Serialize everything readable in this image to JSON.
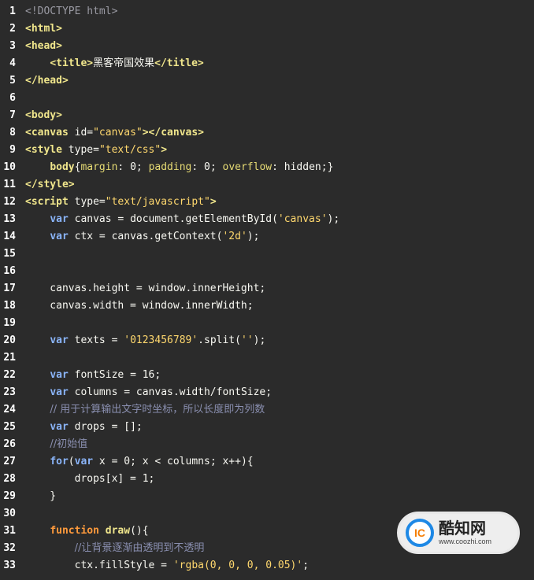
{
  "lines": [
    {
      "n": "1",
      "tokens": [
        {
          "c": "doctype",
          "t": "<!DOCTYPE html>"
        }
      ]
    },
    {
      "n": "2",
      "tokens": [
        {
          "c": "tag",
          "t": "<html>"
        }
      ]
    },
    {
      "n": "3",
      "tokens": [
        {
          "c": "tag",
          "t": "<head>"
        }
      ]
    },
    {
      "n": "4",
      "tokens": [
        {
          "c": "plain",
          "t": "    "
        },
        {
          "c": "tag",
          "t": "<title>"
        },
        {
          "c": "plain cjk",
          "t": "黑客帝国效果"
        },
        {
          "c": "tag",
          "t": "</title>"
        }
      ]
    },
    {
      "n": "5",
      "tokens": [
        {
          "c": "tag",
          "t": "</head>"
        }
      ]
    },
    {
      "n": "6",
      "tokens": []
    },
    {
      "n": "7",
      "tokens": [
        {
          "c": "tag",
          "t": "<body>"
        }
      ]
    },
    {
      "n": "8",
      "tokens": [
        {
          "c": "tag",
          "t": "<canvas"
        },
        {
          "c": "attr",
          "t": " id="
        },
        {
          "c": "str",
          "t": "\"canvas\""
        },
        {
          "c": "tag",
          "t": "></canvas>"
        }
      ]
    },
    {
      "n": "9",
      "tokens": [
        {
          "c": "tag",
          "t": "<style"
        },
        {
          "c": "attr",
          "t": " type="
        },
        {
          "c": "str",
          "t": "\"text/css\""
        },
        {
          "c": "tag",
          "t": ">"
        }
      ]
    },
    {
      "n": "10",
      "tokens": [
        {
          "c": "plain",
          "t": "    "
        },
        {
          "c": "tag",
          "t": "body"
        },
        {
          "c": "plain",
          "t": "{"
        },
        {
          "c": "prop",
          "t": "margin"
        },
        {
          "c": "plain",
          "t": ": 0; "
        },
        {
          "c": "prop",
          "t": "padding"
        },
        {
          "c": "plain",
          "t": ": 0; "
        },
        {
          "c": "prop",
          "t": "overflow"
        },
        {
          "c": "plain",
          "t": ": hidden;}"
        }
      ]
    },
    {
      "n": "11",
      "tokens": [
        {
          "c": "tag",
          "t": "</style>"
        }
      ]
    },
    {
      "n": "12",
      "tokens": [
        {
          "c": "tag",
          "t": "<script"
        },
        {
          "c": "attr",
          "t": " type="
        },
        {
          "c": "str",
          "t": "\"text/javascript\""
        },
        {
          "c": "tag",
          "t": ">"
        }
      ]
    },
    {
      "n": "13",
      "tokens": [
        {
          "c": "plain",
          "t": "    "
        },
        {
          "c": "kw",
          "t": "var"
        },
        {
          "c": "plain",
          "t": " canvas = document.getElementById("
        },
        {
          "c": "str",
          "t": "'canvas'"
        },
        {
          "c": "plain",
          "t": ");"
        }
      ]
    },
    {
      "n": "14",
      "tokens": [
        {
          "c": "plain",
          "t": "    "
        },
        {
          "c": "kw",
          "t": "var"
        },
        {
          "c": "plain",
          "t": " ctx = canvas.getContext("
        },
        {
          "c": "str",
          "t": "'2d'"
        },
        {
          "c": "plain",
          "t": ");"
        }
      ]
    },
    {
      "n": "15",
      "tokens": []
    },
    {
      "n": "16",
      "tokens": []
    },
    {
      "n": "17",
      "tokens": [
        {
          "c": "plain",
          "t": "    canvas.height = window.innerHeight;"
        }
      ]
    },
    {
      "n": "18",
      "tokens": [
        {
          "c": "plain",
          "t": "    canvas.width = window.innerWidth;"
        }
      ]
    },
    {
      "n": "19",
      "tokens": []
    },
    {
      "n": "20",
      "tokens": [
        {
          "c": "plain",
          "t": "    "
        },
        {
          "c": "kw",
          "t": "var"
        },
        {
          "c": "plain",
          "t": " texts = "
        },
        {
          "c": "str",
          "t": "'0123456789'"
        },
        {
          "c": "plain",
          "t": ".split("
        },
        {
          "c": "str",
          "t": "''"
        },
        {
          "c": "plain",
          "t": ");"
        }
      ]
    },
    {
      "n": "21",
      "tokens": []
    },
    {
      "n": "22",
      "tokens": [
        {
          "c": "plain",
          "t": "    "
        },
        {
          "c": "kw",
          "t": "var"
        },
        {
          "c": "plain",
          "t": " fontSize = 16;"
        }
      ]
    },
    {
      "n": "23",
      "tokens": [
        {
          "c": "plain",
          "t": "    "
        },
        {
          "c": "kw",
          "t": "var"
        },
        {
          "c": "plain",
          "t": " columns = canvas.width/fontSize;"
        }
      ]
    },
    {
      "n": "24",
      "tokens": [
        {
          "c": "plain",
          "t": "    "
        },
        {
          "c": "cm cjk",
          "t": "// 用于计算输出文字时坐标，所以长度即为列数"
        }
      ]
    },
    {
      "n": "25",
      "tokens": [
        {
          "c": "plain",
          "t": "    "
        },
        {
          "c": "kw",
          "t": "var"
        },
        {
          "c": "plain",
          "t": " drops = [];"
        }
      ]
    },
    {
      "n": "26",
      "tokens": [
        {
          "c": "plain",
          "t": "    "
        },
        {
          "c": "cm cjk",
          "t": "//初始值"
        }
      ]
    },
    {
      "n": "27",
      "tokens": [
        {
          "c": "plain",
          "t": "    "
        },
        {
          "c": "kw",
          "t": "for"
        },
        {
          "c": "plain",
          "t": "("
        },
        {
          "c": "kw",
          "t": "var"
        },
        {
          "c": "plain",
          "t": " x = 0; x < columns; x++){"
        }
      ]
    },
    {
      "n": "28",
      "tokens": [
        {
          "c": "plain",
          "t": "        drops[x] = 1;"
        }
      ]
    },
    {
      "n": "29",
      "tokens": [
        {
          "c": "plain",
          "t": "    }"
        }
      ]
    },
    {
      "n": "30",
      "tokens": []
    },
    {
      "n": "31",
      "tokens": [
        {
          "c": "plain",
          "t": "    "
        },
        {
          "c": "fn",
          "t": "function"
        },
        {
          "c": "plain",
          "t": " "
        },
        {
          "c": "tag",
          "t": "draw"
        },
        {
          "c": "plain",
          "t": "(){"
        }
      ]
    },
    {
      "n": "32",
      "tokens": [
        {
          "c": "plain",
          "t": "        "
        },
        {
          "c": "cm cjk",
          "t": "//让背景逐渐由透明到不透明"
        }
      ]
    },
    {
      "n": "33",
      "tokens": [
        {
          "c": "plain",
          "t": "        ctx.fillStyle = "
        },
        {
          "c": "str",
          "t": "'rgba(0, 0, 0, 0.05)'"
        },
        {
          "c": "plain",
          "t": ";"
        }
      ]
    }
  ],
  "watermark": {
    "logo_text": "IC",
    "title": "酷知网",
    "url": "www.coozhi.com"
  }
}
